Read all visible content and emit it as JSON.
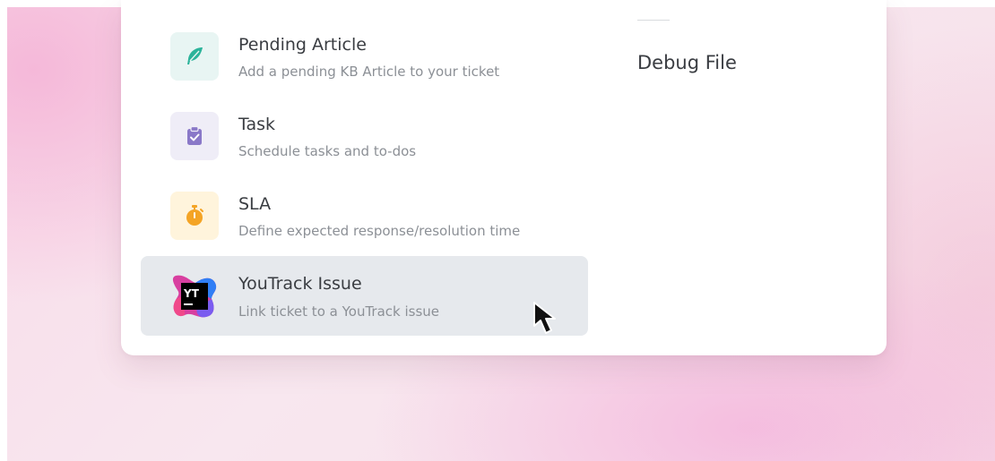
{
  "menu": {
    "items": [
      {
        "title": "Pending Article",
        "description": "Add a pending KB Article to your ticket",
        "icon": "feather-icon",
        "icon_bg": "#e8f5f3",
        "icon_color": "#2bb39a"
      },
      {
        "title": "Task",
        "description": "Schedule tasks and to-dos",
        "icon": "clipboard-check-icon",
        "icon_bg": "#efedf7",
        "icon_color": "#8a78c8"
      },
      {
        "title": "SLA",
        "description": "Define expected response/resolution time",
        "icon": "stopwatch-icon",
        "icon_bg": "#fff4dc",
        "icon_color": "#f4a425"
      },
      {
        "title": "YouTrack Issue",
        "description": "Link ticket to a YouTrack issue",
        "icon": "youtrack-logo-icon",
        "icon_text": "YT",
        "selected": true
      }
    ]
  },
  "side_panel": {
    "label": "Debug File"
  },
  "colors": {
    "selected_bg": "#e6e9ed",
    "title_text": "#3a3d42",
    "desc_text": "#8c9096"
  }
}
